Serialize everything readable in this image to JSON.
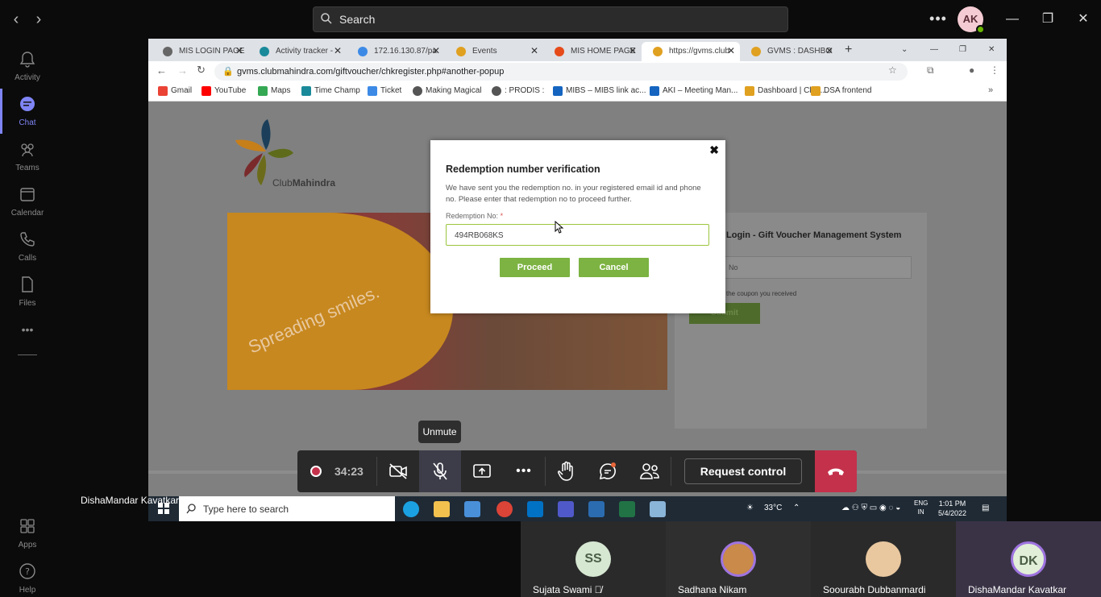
{
  "teams": {
    "search_placeholder": "Search",
    "user_initials": "AK",
    "rail": [
      {
        "label": "Activity",
        "icon": "bell-icon"
      },
      {
        "label": "Chat",
        "icon": "chat-icon"
      },
      {
        "label": "Teams",
        "icon": "teams-icon"
      },
      {
        "label": "Calendar",
        "icon": "calendar-icon"
      },
      {
        "label": "Calls",
        "icon": "phone-icon"
      },
      {
        "label": "Files",
        "icon": "file-icon"
      },
      {
        "label": "Apps",
        "icon": "apps-icon"
      },
      {
        "label": "Help",
        "icon": "help-icon"
      }
    ],
    "accent": "#7f85f5"
  },
  "browser": {
    "tabs": [
      {
        "title": "MIS LOGIN PAGE"
      },
      {
        "title": "Activity tracker -"
      },
      {
        "title": "172.16.130.87/pa"
      },
      {
        "title": "Events"
      },
      {
        "title": "MIS HOME PAGE"
      },
      {
        "title": "https://gvms.club"
      },
      {
        "title": "GVMS : DASHBO"
      }
    ],
    "url": "gvms.clubmahindra.com/giftvoucher/chkregister.php#another-popup",
    "bookmarks": [
      "Gmail",
      "YouTube",
      "Maps",
      "Time Champ",
      "Ticket",
      "Making Magical",
      ": PRODIS :",
      "MIBS – MIBS link ac...",
      "AKI – Meeting Man...",
      "Dashboard | Club...",
      "DSA frontend"
    ]
  },
  "site": {
    "brand_prefix": "Club",
    "brand_bold": "Mahindra",
    "hero_text": "Spreading smiles.",
    "login_title": "Login - Gift Voucher Management System",
    "login_input_placeholder": "No",
    "login_hint": "the coupon you received",
    "login_button": "Submit"
  },
  "modal": {
    "title": "Redemption number verification",
    "message": "We have sent you the redemption no. in your registered email id and phone no. Please enter that redemption no to proceed further.",
    "field_label": "Redemption No:",
    "required_mark": "*",
    "field_value": "494RB068KS",
    "proceed_label": "Proceed",
    "cancel_label": "Cancel",
    "close_glyph": "✖"
  },
  "taskbar": {
    "search_placeholder": "Type here to search",
    "weather": "33°C",
    "lang_top": "ENG",
    "lang_bottom": "IN",
    "time": "1:01 PM",
    "date": "5/4/2022"
  },
  "call": {
    "timer": "34:23",
    "tooltip": "Unmute",
    "request_control": "Request control",
    "presenter": "DishaMandar Kavatkar",
    "participants": [
      {
        "name": "Sujata Swami",
        "initials": "SS",
        "muted": true
      },
      {
        "name": "Sadhana Nikam",
        "initials": "",
        "muted": false
      },
      {
        "name": "Soourabh Dubbanmardi",
        "initials": "",
        "muted": false
      },
      {
        "name": "DishaMandar Kavatkar",
        "initials": "DK",
        "muted": false
      }
    ],
    "hangup_color": "#c4314b"
  }
}
